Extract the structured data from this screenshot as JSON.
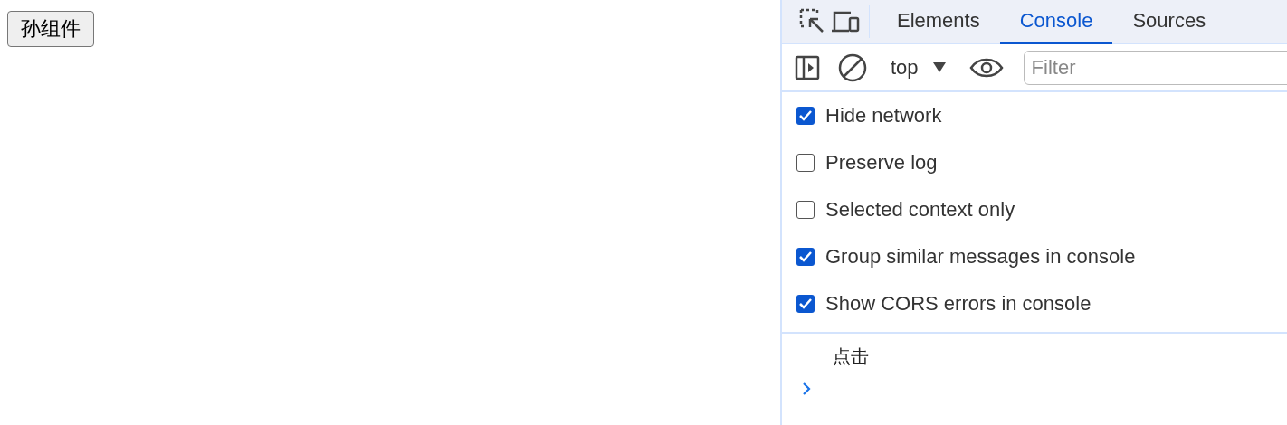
{
  "page": {
    "button": "孙组件"
  },
  "devtools": {
    "tabs": [
      {
        "label": "Elements",
        "selected": false
      },
      {
        "label": "Console",
        "selected": true
      },
      {
        "label": "Sources",
        "selected": false
      }
    ],
    "toolbar": {
      "context": "top",
      "filter_placeholder": "Filter"
    },
    "settings": [
      {
        "label": "Hide network",
        "checked": true
      },
      {
        "label": "Preserve log",
        "checked": false
      },
      {
        "label": "Selected context only",
        "checked": false
      },
      {
        "label": "Group similar messages in console",
        "checked": true
      },
      {
        "label": "Show CORS errors in console",
        "checked": true
      }
    ],
    "messages": [
      "点击"
    ]
  }
}
